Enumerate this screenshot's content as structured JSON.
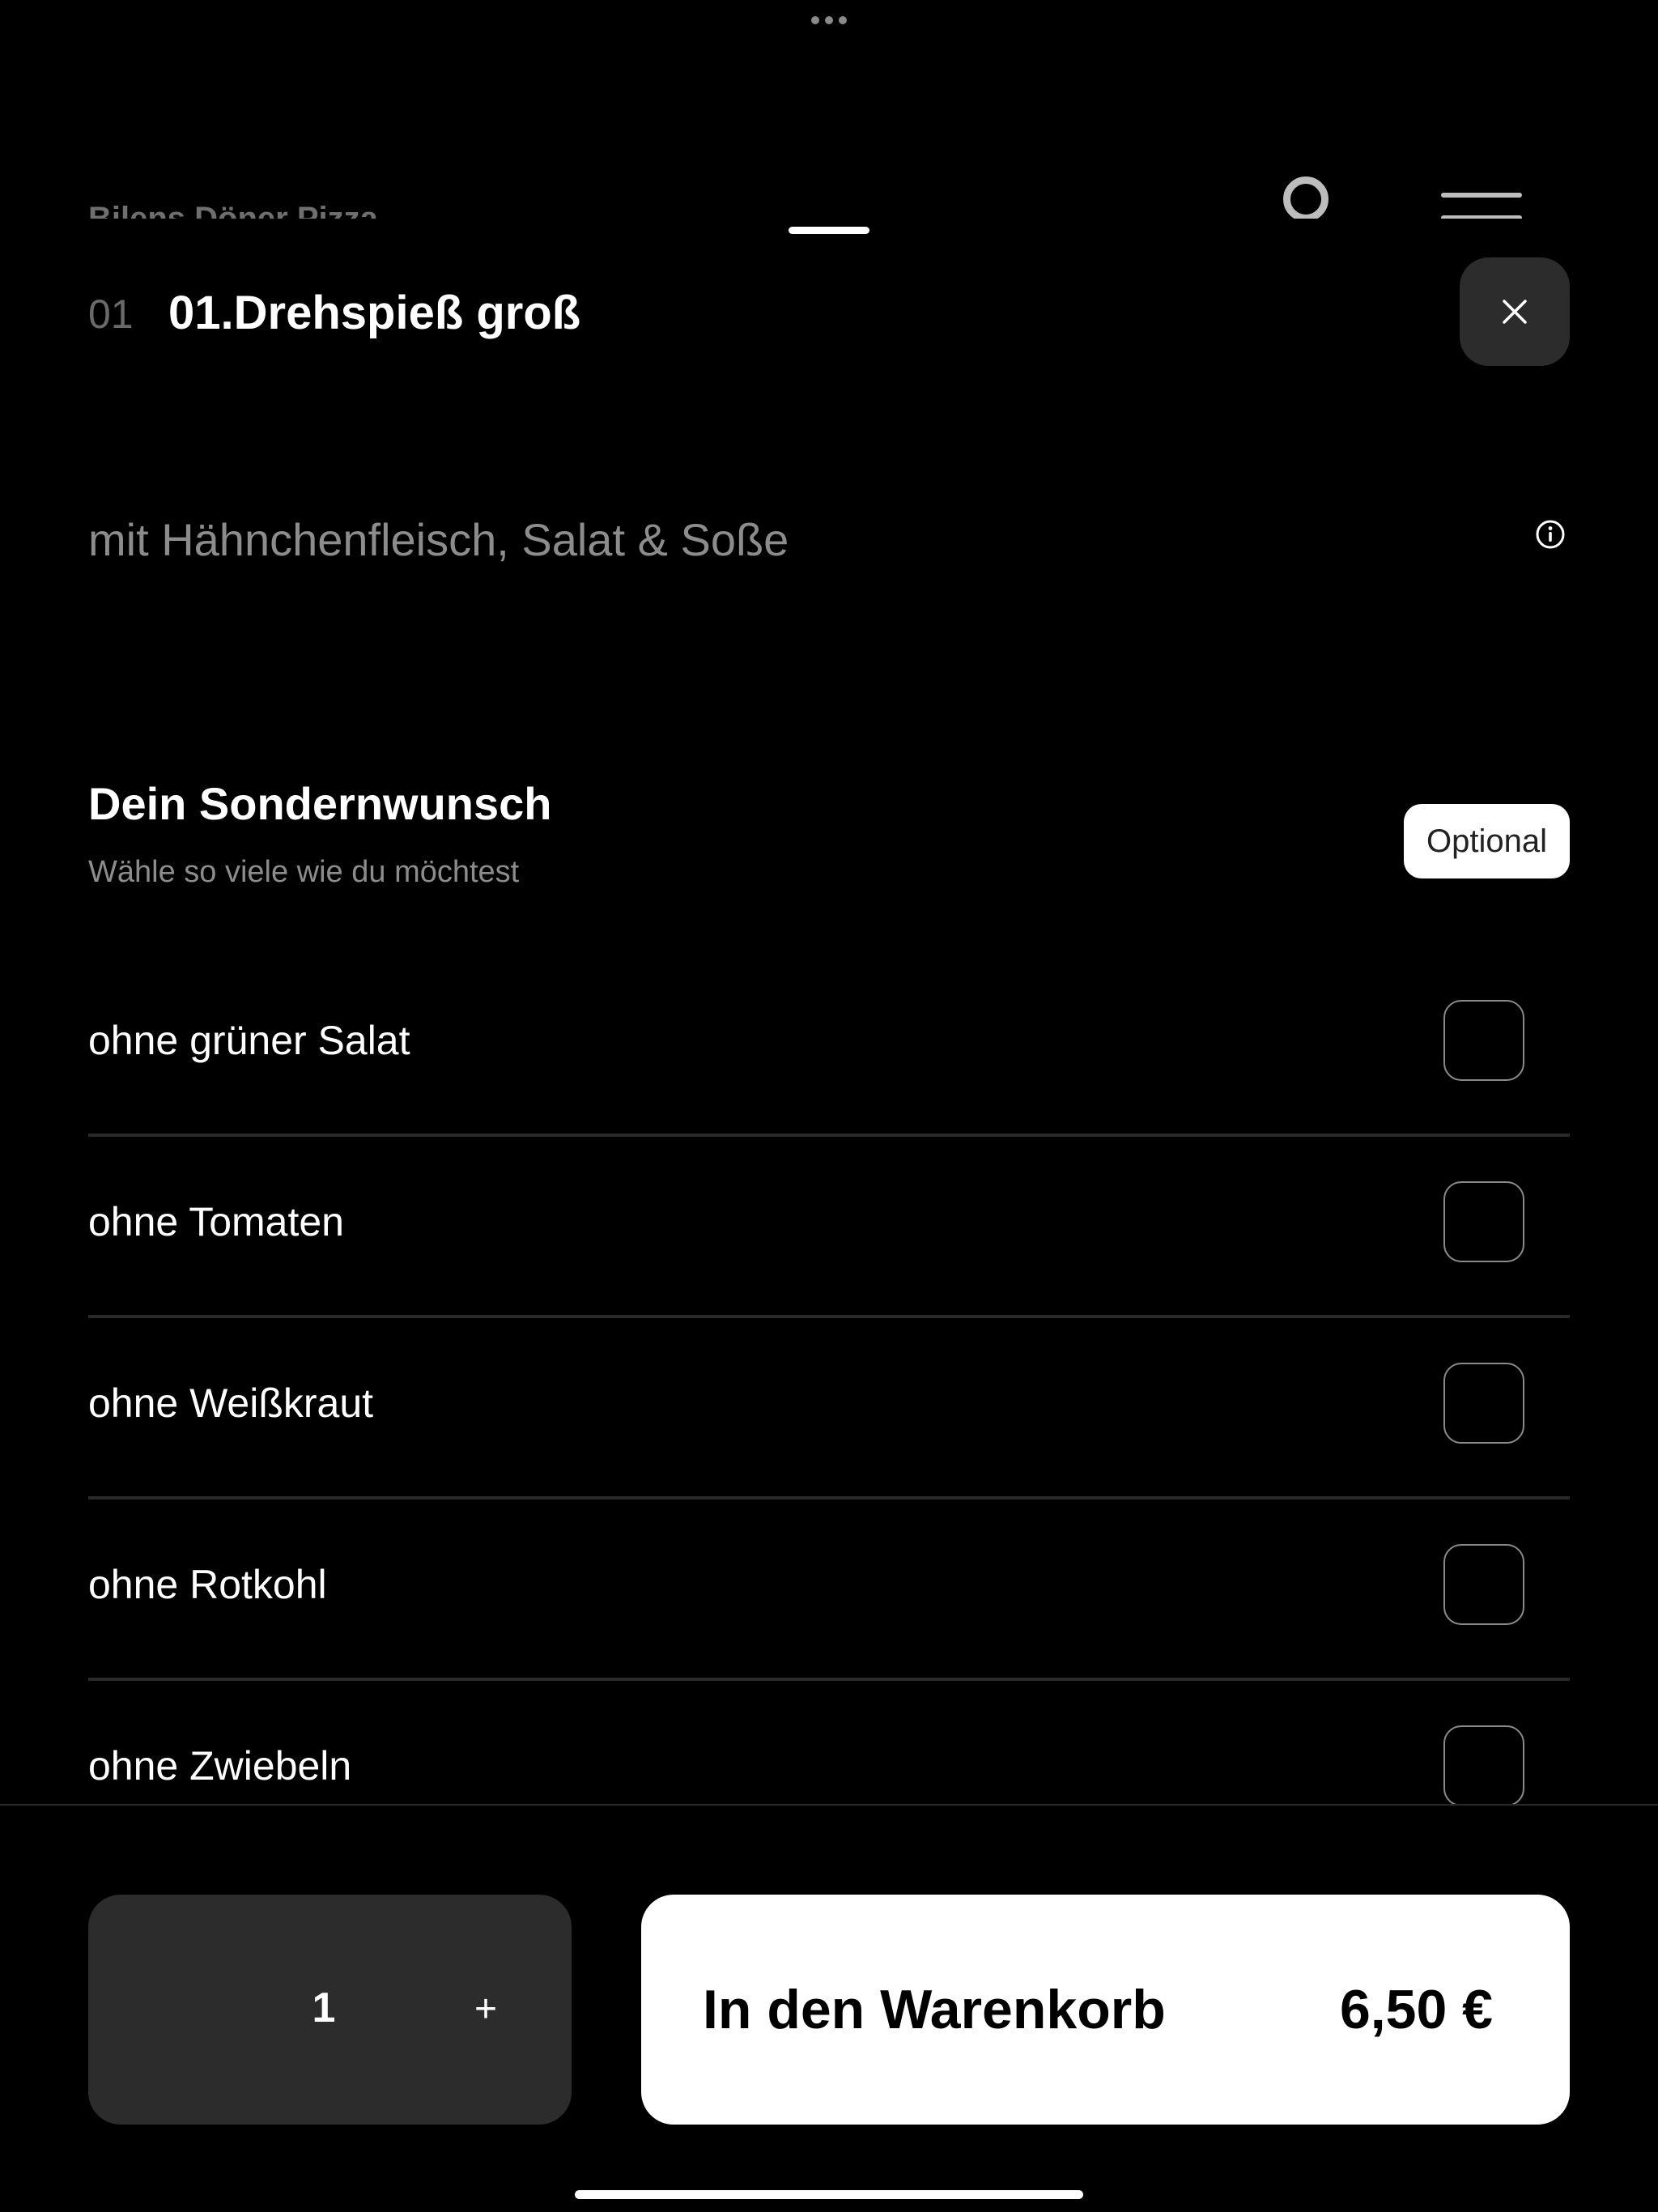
{
  "background": {
    "store_name": "Bilens Döner  Pizza"
  },
  "item": {
    "number": "01",
    "title": "01.Drehspieß groß",
    "description": "mit Hähnchenfleisch, Salat & Soße"
  },
  "section": {
    "title": "Dein Sondernwunsch",
    "subtitle": "Wähle so viele wie du möchtest",
    "badge": "Optional"
  },
  "options": [
    {
      "label": "ohne grüner Salat",
      "checked": false
    },
    {
      "label": "ohne Tomaten",
      "checked": false
    },
    {
      "label": "ohne Weißkraut",
      "checked": false
    },
    {
      "label": "ohne Rotkohl",
      "checked": false
    },
    {
      "label": "ohne Zwiebeln",
      "checked": false
    }
  ],
  "footer": {
    "quantity": "1",
    "plus_symbol": "+",
    "add_to_cart_label": "In den Warenkorb",
    "price": "6,50 €"
  },
  "icons": {
    "close": "close-icon",
    "info": "info-icon",
    "profile": "profile-icon",
    "menu": "menu-icon"
  },
  "colors": {
    "background": "#000000",
    "surface": "#2c2c2c",
    "primary_text": "#ffffff",
    "secondary_text": "#8c8c8c",
    "cta_background": "#ffffff",
    "cta_text": "#000000"
  }
}
